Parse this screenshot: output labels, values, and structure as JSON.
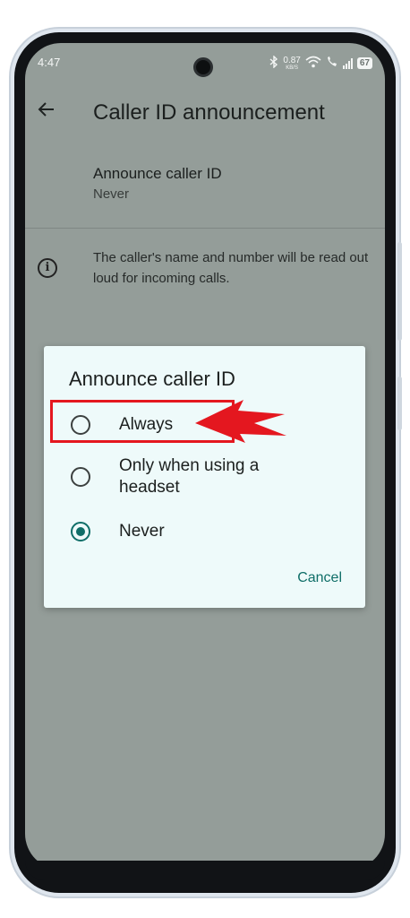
{
  "status_bar": {
    "time": "4:47",
    "net_speed_value": "0.87",
    "net_speed_unit": "KB/S",
    "battery": "67",
    "icons": [
      "bluetooth-icon",
      "wifi-icon",
      "wifi-call-icon",
      "signal-icon",
      "battery-icon"
    ]
  },
  "header": {
    "title": "Caller ID announcement",
    "back_icon": "arrow-left-icon"
  },
  "setting": {
    "label": "Announce caller ID",
    "value": "Never"
  },
  "info": {
    "icon": "info-icon",
    "text": "The caller's name and number will be read out loud for incoming calls."
  },
  "dialog": {
    "title": "Announce caller ID",
    "options": [
      {
        "label": "Always",
        "selected": false
      },
      {
        "label": "Only when using a headset",
        "selected": false
      },
      {
        "label": "Never",
        "selected": true
      }
    ],
    "cancel_label": "Cancel"
  },
  "colors": {
    "screen_overlay": "#949d99",
    "dialog_bg": "#eefafa",
    "accent": "#0f6e68",
    "annotation": "#e4171f"
  }
}
